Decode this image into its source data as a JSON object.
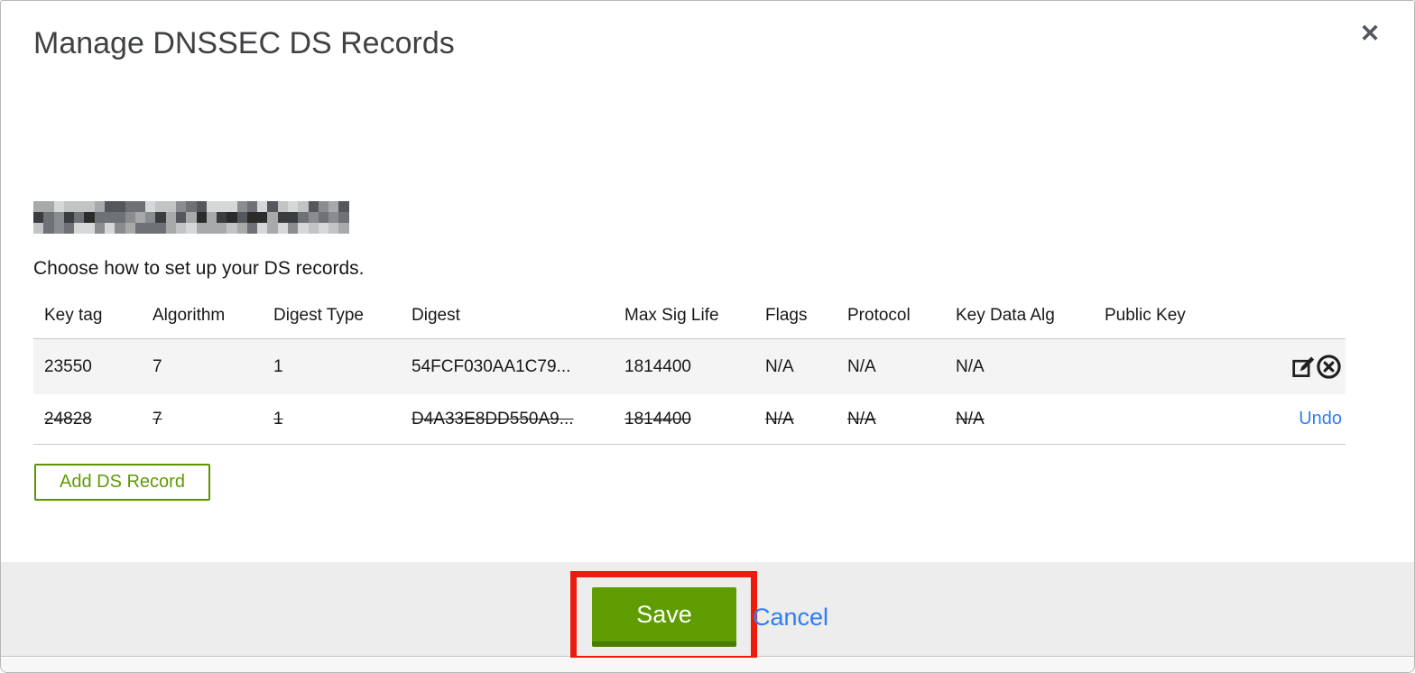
{
  "modal": {
    "title": "Manage DNSSEC DS Records",
    "close_icon": "✕",
    "instruction": "Choose how to set up your DS records.",
    "domain_redacted": true
  },
  "table": {
    "columns": [
      "Key tag",
      "Algorithm",
      "Digest Type",
      "Digest",
      "Max Sig Life",
      "Flags",
      "Protocol",
      "Key Data Alg",
      "Public Key"
    ],
    "rows": [
      {
        "cells": [
          "23550",
          "7",
          "1",
          "54FCF030AA1C79...",
          "1814400",
          "N/A",
          "N/A",
          "N/A",
          ""
        ],
        "deleted": false,
        "actions": [
          "edit-icon",
          "remove-icon"
        ]
      },
      {
        "cells": [
          "24828",
          "7",
          "1",
          "D4A33E8DD550A9...",
          "1814400",
          "N/A",
          "N/A",
          "N/A",
          ""
        ],
        "deleted": true,
        "undo_label": "Undo"
      }
    ]
  },
  "buttons": {
    "add_ds_record": "Add DS Record",
    "save": "Save",
    "cancel": "Cancel"
  },
  "colors": {
    "primary_green": "#5e9c00",
    "green_shadow": "#4a7c00",
    "link_blue": "#2e7df6",
    "annotation_red": "#eb1c0e",
    "footer_bg": "#ededed",
    "row_existing_bg": "#f4f4f4"
  }
}
